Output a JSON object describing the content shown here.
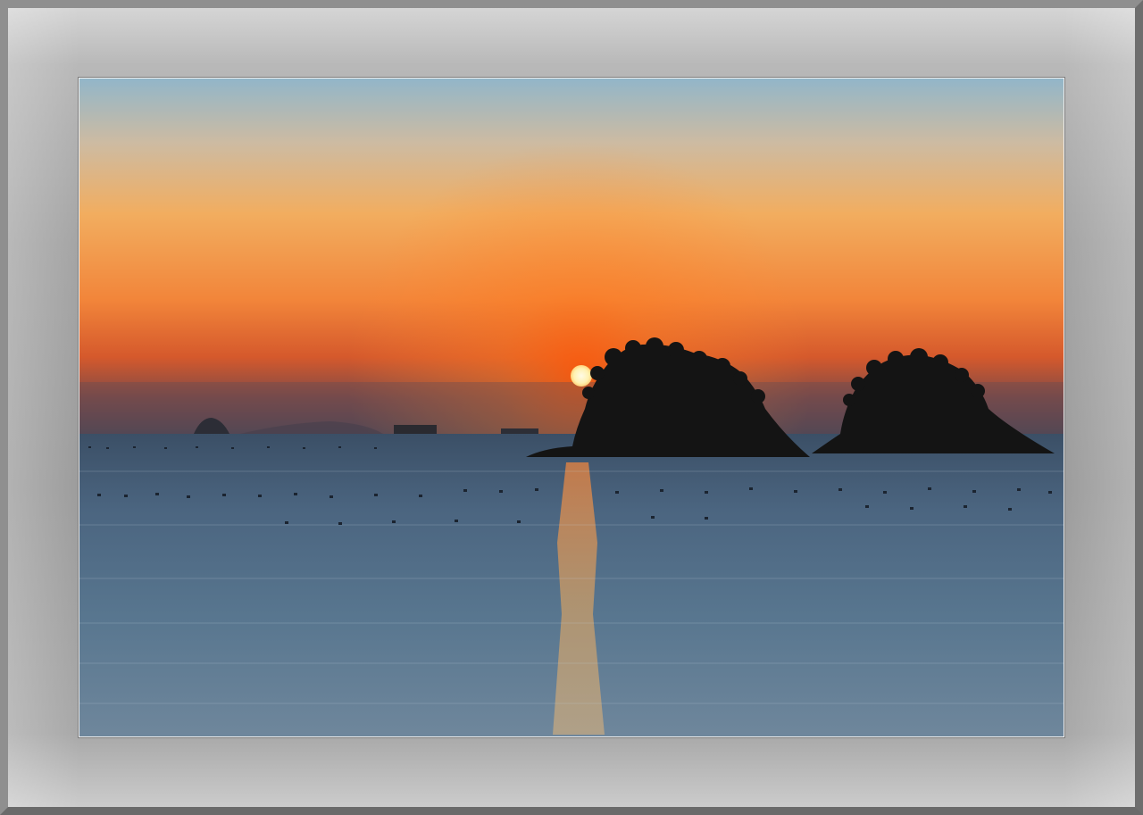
{
  "scene": {
    "subject": "sunset-over-sea-with-islands",
    "colors": {
      "sky_top": "#8fb3c4",
      "sky_mid": "#f3a24e",
      "sky_glow": "#f26a1a",
      "horizon_haze": "#5a4a52",
      "sun": "#fff4c0",
      "sea_top": "#3e556e",
      "sea_bottom": "#5c7c98",
      "island": "#151515",
      "mat": "#a3a3a3"
    }
  }
}
